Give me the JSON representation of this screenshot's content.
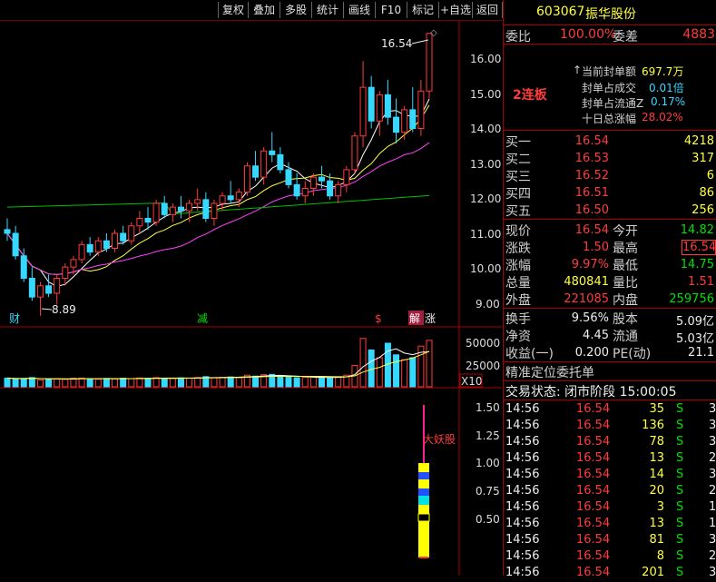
{
  "toolbar": {
    "buttons": [
      "复权",
      "叠加",
      "多股",
      "统计",
      "画线",
      "F10",
      "标记",
      "+自选",
      "返回"
    ]
  },
  "chart": {
    "price_ticks": [
      "16.00",
      "15.00",
      "14.00",
      "13.00",
      "12.00",
      "11.00",
      "10.00",
      "9.00"
    ],
    "high_label": "16.54",
    "low_label": "8.89",
    "events": [
      "财",
      "减",
      "$",
      "解",
      "涨"
    ],
    "volume_ticks": [
      "50000",
      "25000"
    ],
    "volume_unit": "X10",
    "indicator_ticks": [
      "1.50",
      "1.25",
      "1.00",
      "0.75",
      "0.50"
    ],
    "indicator_label": "大妖股",
    "chart_data": {
      "type": "line",
      "price_range": [
        8.8,
        16.8
      ],
      "candles": [
        [
          11.3,
          11.6,
          11.0,
          11.2
        ],
        [
          11.2,
          11.4,
          10.5,
          10.6
        ],
        [
          10.6,
          10.8,
          9.9,
          10.0
        ],
        [
          10.0,
          10.3,
          9.4,
          9.5
        ],
        [
          9.5,
          9.9,
          9.0,
          9.8
        ],
        [
          9.8,
          10.1,
          9.5,
          9.6
        ],
        [
          9.6,
          10.1,
          9.3,
          10.0
        ],
        [
          10.0,
          10.4,
          9.8,
          10.3
        ],
        [
          10.3,
          10.6,
          10.1,
          10.5
        ],
        [
          10.5,
          11.0,
          10.4,
          10.9
        ],
        [
          10.9,
          11.1,
          10.6,
          10.7
        ],
        [
          10.7,
          11.1,
          10.6,
          11.0
        ],
        [
          11.0,
          11.2,
          10.7,
          10.8
        ],
        [
          10.8,
          11.3,
          10.7,
          11.2
        ],
        [
          11.2,
          11.4,
          10.9,
          11.0
        ],
        [
          11.0,
          11.5,
          10.9,
          11.4
        ],
        [
          11.4,
          11.8,
          11.2,
          11.6
        ],
        [
          11.6,
          11.9,
          11.3,
          11.5
        ],
        [
          11.5,
          12.1,
          11.4,
          12.0
        ],
        [
          12.0,
          12.2,
          11.6,
          11.7
        ],
        [
          11.7,
          12.0,
          11.5,
          11.9
        ],
        [
          11.9,
          12.2,
          11.6,
          11.8
        ],
        [
          11.8,
          12.1,
          11.5,
          12.0
        ],
        [
          12.0,
          12.4,
          11.8,
          12.1
        ],
        [
          12.1,
          12.3,
          11.5,
          11.6
        ],
        [
          11.6,
          12.1,
          11.4,
          12.0
        ],
        [
          12.0,
          12.3,
          11.8,
          12.2
        ],
        [
          12.2,
          12.6,
          12.0,
          12.1
        ],
        [
          12.1,
          12.4,
          11.9,
          12.3
        ],
        [
          12.3,
          13.1,
          12.2,
          13.0
        ],
        [
          13.0,
          13.4,
          12.6,
          12.7
        ],
        [
          12.7,
          13.5,
          12.5,
          13.4
        ],
        [
          13.4,
          13.9,
          13.1,
          13.3
        ],
        [
          13.3,
          13.5,
          12.8,
          12.9
        ],
        [
          12.9,
          13.1,
          12.4,
          12.5
        ],
        [
          12.5,
          12.8,
          12.1,
          12.2
        ],
        [
          12.2,
          12.6,
          12.0,
          12.4
        ],
        [
          12.4,
          12.8,
          12.2,
          12.7
        ],
        [
          12.7,
          13.0,
          12.4,
          12.6
        ],
        [
          12.6,
          12.8,
          12.1,
          12.2
        ],
        [
          12.2,
          12.6,
          12.0,
          12.5
        ],
        [
          12.5,
          13.0,
          12.3,
          12.9
        ],
        [
          12.9,
          13.9,
          12.8,
          13.8
        ],
        [
          13.8,
          15.8,
          13.5,
          15.1
        ],
        [
          15.1,
          15.4,
          14.0,
          14.2
        ],
        [
          14.2,
          15.0,
          13.8,
          14.9
        ],
        [
          14.9,
          15.3,
          14.1,
          14.3
        ],
        [
          14.3,
          14.8,
          13.6,
          13.9
        ],
        [
          13.9,
          14.6,
          13.7,
          14.5
        ],
        [
          14.5,
          15.1,
          13.9,
          14.0
        ],
        [
          14.0,
          15.3,
          13.8,
          15.0
        ],
        [
          15.0,
          16.54,
          14.8,
          16.54
        ]
      ],
      "volume_range": [
        0,
        60000
      ],
      "volume": [
        9000,
        8000,
        8500,
        9500,
        7000,
        8000,
        8200,
        7600,
        8800,
        9000,
        8300,
        7900,
        8600,
        8100,
        8900,
        8400,
        9100,
        8800,
        9500,
        9000,
        8700,
        9200,
        8900,
        9600,
        10500,
        9400,
        9800,
        10200,
        9900,
        12000,
        11000,
        12500,
        12800,
        10800,
        9800,
        9400,
        9700,
        10100,
        9600,
        9300,
        9800,
        12000,
        22000,
        50000,
        38000,
        30000,
        45000,
        33000,
        28000,
        30000,
        42000,
        48000
      ]
    }
  },
  "panel": {
    "code": "603067",
    "name": "振华股份",
    "weibi_label": "委比",
    "weibi_value": "100.00%",
    "weicha_label": "委差",
    "weicha_value": "4883",
    "streak": "2连板",
    "seal_amount_label": "当前封单额",
    "seal_amount_value": "697.7万",
    "seal_deal_label": "封单占成交",
    "seal_deal_value": "0.01倍",
    "seal_float_label": "封单占流通Z",
    "seal_float_value": "0.17%",
    "ten_day_label": "十日总涨幅",
    "ten_day_value": "28.02%",
    "bids": [
      {
        "label": "买一",
        "price": "16.54",
        "vol": "4218"
      },
      {
        "label": "买二",
        "price": "16.53",
        "vol": "317"
      },
      {
        "label": "买三",
        "price": "16.52",
        "vol": "6"
      },
      {
        "label": "买四",
        "price": "16.51",
        "vol": "86"
      },
      {
        "label": "买五",
        "price": "16.50",
        "vol": "256"
      }
    ],
    "quote": {
      "xianjia_l": "现价",
      "xianjia": "16.54",
      "jinkai_l": "今开",
      "jinkai": "14.82",
      "zhangdie_l": "涨跌",
      "zhangdie": "1.50",
      "zuigao_l": "最高",
      "zuigao": "16.54",
      "zhangfu_l": "涨幅",
      "zhangfu": "9.97%",
      "zuidi_l": "最低",
      "zuidi": "14.75",
      "zongliang_l": "总量",
      "zongliang": "480841",
      "liangbi_l": "量比",
      "liangbi": "1.51",
      "waipan_l": "外盘",
      "waipan": "221085",
      "neipan_l": "内盘",
      "neipan": "259756",
      "huanshou_l": "换手",
      "huanshou": "9.56%",
      "guben_l": "股本",
      "guben": "5.09亿",
      "jingzi_l": "净资",
      "jingzi": "4.45",
      "liutong_l": "流通",
      "liutong": "5.03亿",
      "shouyi_l": "收益(一)",
      "shouyi": "0.200",
      "pe_l": "PE(动)",
      "pe": "21.1"
    },
    "precise_label": "精准定位委托单",
    "status_label": "交易状态: 闭市阶段 15:00:05",
    "trades": [
      {
        "time": "14:56",
        "price": "16.54",
        "vol": "35",
        "side": "S",
        "n": "3"
      },
      {
        "time": "14:56",
        "price": "16.54",
        "vol": "136",
        "side": "S",
        "n": "3"
      },
      {
        "time": "14:56",
        "price": "16.54",
        "vol": "78",
        "side": "S",
        "n": "3"
      },
      {
        "time": "14:56",
        "price": "16.54",
        "vol": "13",
        "side": "S",
        "n": "2"
      },
      {
        "time": "14:56",
        "price": "16.54",
        "vol": "14",
        "side": "S",
        "n": "3"
      },
      {
        "time": "14:56",
        "price": "16.54",
        "vol": "20",
        "side": "S",
        "n": "2"
      },
      {
        "time": "14:56",
        "price": "16.54",
        "vol": "3",
        "side": "S",
        "n": "1"
      },
      {
        "time": "14:56",
        "price": "16.54",
        "vol": "13",
        "side": "S",
        "n": "1"
      },
      {
        "time": "14:56",
        "price": "16.54",
        "vol": "81",
        "side": "S",
        "n": "3"
      },
      {
        "time": "14:56",
        "price": "16.54",
        "vol": "8",
        "side": "S",
        "n": "2"
      },
      {
        "time": "14:56",
        "price": "16.54",
        "vol": "201",
        "side": "S",
        "n": "3"
      }
    ]
  }
}
